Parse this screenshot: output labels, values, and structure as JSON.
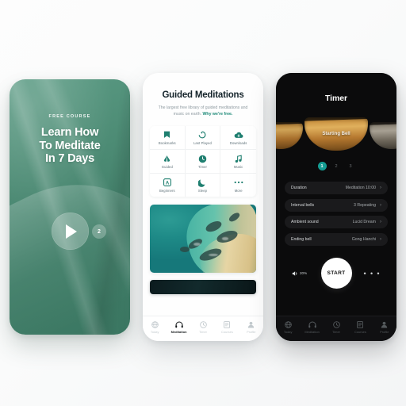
{
  "app": {
    "accent_teal": "#1e8a78",
    "accent_dot": "#149d93",
    "page_background": "#fafbfb"
  },
  "phone_course": {
    "kicker": "FREE COURSE",
    "title_line1": "Learn How",
    "title_line2": "To Meditate",
    "title_line3": "In 7 Days",
    "play_icon": "play-icon",
    "badge_count": "2"
  },
  "phone_library": {
    "title": "Guided Meditations",
    "subtitle": "The largest free library of guided meditations and music on earth.",
    "subtitle_link": "Why we're free.",
    "grid": [
      {
        "label": "Bookmarks",
        "icon": "bookmark-icon"
      },
      {
        "label": "Last Played",
        "icon": "history-icon"
      },
      {
        "label": "Downloads",
        "icon": "download-cloud-icon"
      },
      {
        "label": "Guided",
        "icon": "praying-hands-icon"
      },
      {
        "label": "Timer",
        "icon": "clock-icon"
      },
      {
        "label": "Music",
        "icon": "music-note-icon"
      },
      {
        "label": "Beginners",
        "icon": "letter-a-icon"
      },
      {
        "label": "Sleep",
        "icon": "moon-icon"
      },
      {
        "label": "More",
        "icon": "ellipsis-icon"
      }
    ],
    "featured_image_alt": "aerial-coastline-photo",
    "tabs": [
      {
        "label": "Today",
        "icon": "globe-icon",
        "active": false
      },
      {
        "label": "Meditation",
        "icon": "headphones-icon",
        "active": true
      },
      {
        "label": "Timer",
        "icon": "clock-icon",
        "active": false
      },
      {
        "label": "Courses",
        "icon": "book-icon",
        "active": false
      },
      {
        "label": "Profile",
        "icon": "person-icon",
        "active": false
      }
    ]
  },
  "phone_timer": {
    "title": "Timer",
    "bowl_label": "Starting Bell",
    "pagination": [
      "1",
      "2",
      "3"
    ],
    "active_page": "1",
    "settings": [
      {
        "key": "Duration",
        "value": "Meditation 10:00"
      },
      {
        "key": "Interval bells",
        "value": "3 Repeating"
      },
      {
        "key": "Ambient sound",
        "value": "Lucid Dream"
      },
      {
        "key": "Ending bell",
        "value": "Gong Hanchi"
      }
    ],
    "chevron": "›",
    "volume_icon": "speaker-icon",
    "volume_value": "20%",
    "start_label": "START",
    "more_label": "• • •",
    "tabs": [
      {
        "label": "Today",
        "icon": "globe-icon",
        "active": false
      },
      {
        "label": "Meditation",
        "icon": "headphones-icon",
        "active": false
      },
      {
        "label": "Timer",
        "icon": "clock-icon",
        "active": false
      },
      {
        "label": "Courses",
        "icon": "book-icon",
        "active": false
      },
      {
        "label": "Profile",
        "icon": "person-icon",
        "active": false
      }
    ]
  }
}
